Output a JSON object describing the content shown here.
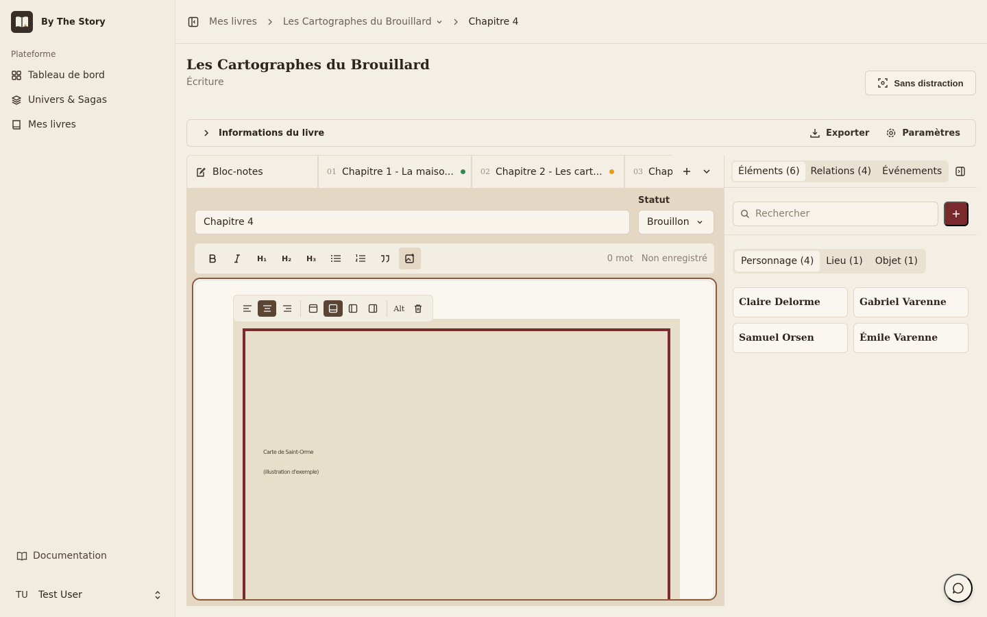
{
  "app": {
    "name": "By The Story"
  },
  "sidebar": {
    "section": "Plateforme",
    "items": [
      {
        "label": "Tableau de bord",
        "icon": "grid-icon"
      },
      {
        "label": "Univers & Sagas",
        "icon": "layers-icon"
      },
      {
        "label": "Mes livres",
        "icon": "book-icon"
      }
    ],
    "documentation": "Documentation",
    "user": {
      "initials": "TU",
      "name": "Test User"
    }
  },
  "breadcrumb": {
    "items": [
      "Mes livres",
      "Les Cartographes du Brouillard",
      "Chapitre 4"
    ]
  },
  "header": {
    "title": "Les Cartographes du Brouillard",
    "subtitle": "Écriture",
    "focus_button": "Sans distraction"
  },
  "info_bar": {
    "label": "Informations du livre",
    "export": "Exporter",
    "settings": "Paramètres"
  },
  "tabs": {
    "notes": "Bloc-notes",
    "chapters": [
      {
        "num": "01",
        "label": "Chapitre 1 - La maiso...",
        "status_color": "#2f8a4f"
      },
      {
        "num": "02",
        "label": "Chapitre 2 - Les cart...",
        "status_color": "#e89a1c"
      },
      {
        "num": "03",
        "label": "Chap"
      }
    ]
  },
  "editor": {
    "chapter_title_value": "Chapitre 4",
    "status_label": "Statut",
    "status_value": "Brouillon",
    "word_count": "0 mot",
    "save_state": "Non enregistré",
    "image_toolbar": {
      "alt": "Alt"
    },
    "figure": {
      "caption_line1": "Carte de Saint-Orme",
      "caption_line2": "(illustration d'exemple)"
    }
  },
  "right_panel": {
    "tabs": [
      "Éléments (6)",
      "Relations (4)",
      "Événements"
    ],
    "search_placeholder": "Rechercher",
    "categories": [
      "Personnage (4)",
      "Lieu (1)",
      "Objet (1)"
    ],
    "cards": [
      "Claire Delorme",
      "Gabriel Varenne",
      "Samuel Orsen",
      "Émile Varenne"
    ]
  },
  "colors": {
    "accent": "#7a2a2a",
    "background": "#f4efe4",
    "editor_panel": "#e4d7c4"
  }
}
